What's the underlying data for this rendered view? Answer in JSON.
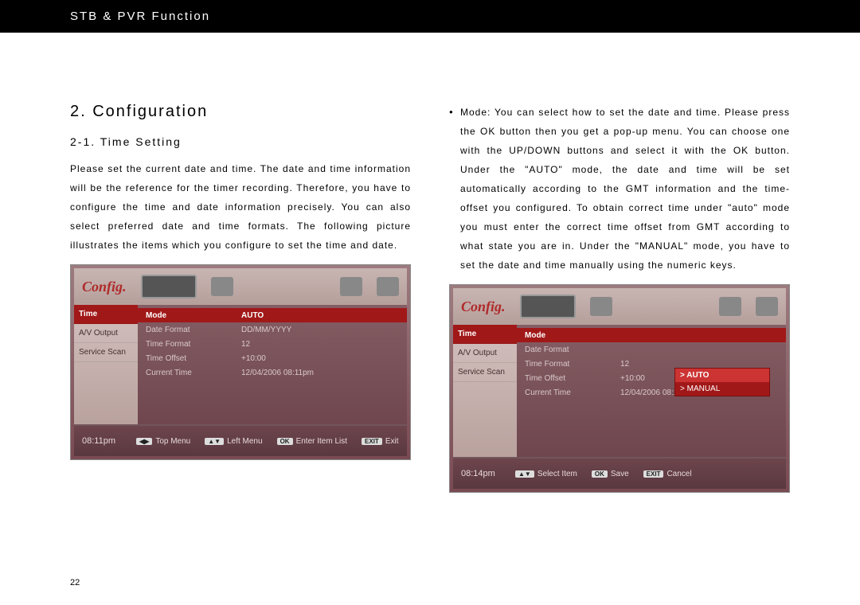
{
  "header": "STB & PVR Function",
  "section_title": "2. Configuration",
  "subsection_title": "2-1. Time Setting",
  "left_text": "Please set the current date and time. The date and time information will be the reference for the timer recording. Therefore, you have to configure the time and date information precisely. You can also select preferred date and time formats. The following picture illustrates the items which you configure to set the time and date.",
  "bullet1": "Mode: You can select how to set the date and time. Please press the OK button then you get a pop-up menu. You can choose one with the UP/DOWN buttons and select it with the OK button. Under the \"AUTO\" mode, the date and time will be set automatically according to the GMT information and the time-offset you configured. To obtain correct time under \"auto\" mode you must enter the correct time offset from GMT according to what state you are in. Under the \"MANUAL\" mode, you have to set the date and time manually using the numeric keys.",
  "page_number": "22",
  "shot1": {
    "logo": "Config.",
    "side": [
      "Time",
      "A/V Output",
      "Service Scan"
    ],
    "rows": [
      {
        "label": "Mode",
        "value": "AUTO"
      },
      {
        "label": "Date Format",
        "value": "DD/MM/YYYY"
      },
      {
        "label": "Time Format",
        "value": "12"
      },
      {
        "label": "Time Offset",
        "value": "+10:00"
      },
      {
        "label": "Current Time",
        "value": "12/04/2006 08:11pm"
      }
    ],
    "clock": "08:11pm",
    "hints": [
      {
        "key": "◀▶",
        "label": "Top Menu"
      },
      {
        "key": "▲▼",
        "label": "Left Menu"
      },
      {
        "key": "OK",
        "label": "Enter Item List"
      },
      {
        "key": "EXIT",
        "label": "Exit"
      }
    ]
  },
  "shot2": {
    "logo": "Config.",
    "side": [
      "Time",
      "A/V Output",
      "Service Scan"
    ],
    "rows": [
      {
        "label": "Mode",
        "value": ""
      },
      {
        "label": "Date Format",
        "value": ""
      },
      {
        "label": "Time Format",
        "value": "12"
      },
      {
        "label": "Time Offset",
        "value": "+10:00"
      },
      {
        "label": "Current Time",
        "value": "12/04/2006 08:14pm"
      }
    ],
    "popup": [
      "> AUTO",
      "> MANUAL"
    ],
    "clock": "08:14pm",
    "hints": [
      {
        "key": "▲▼",
        "label": "Select Item"
      },
      {
        "key": "OK",
        "label": "Save"
      },
      {
        "key": "EXIT",
        "label": "Cancel"
      }
    ]
  }
}
